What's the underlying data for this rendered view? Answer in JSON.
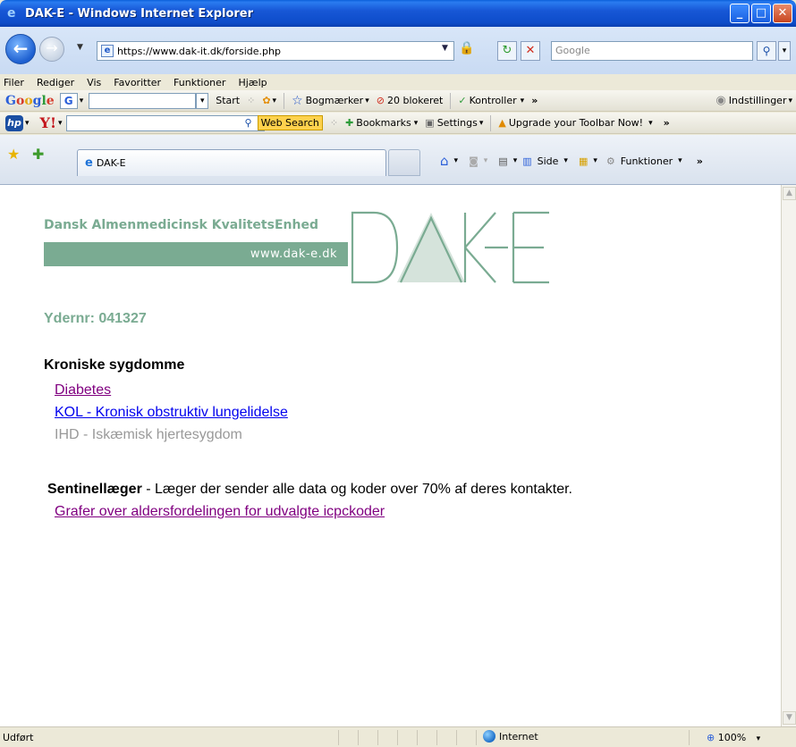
{
  "window": {
    "title": "DAK-E - Windows Internet Explorer"
  },
  "addressbar": {
    "url": "https://www.dak-it.dk/forside.php",
    "search_placeholder": "Google"
  },
  "menu": [
    "Filer",
    "Rediger",
    "Vis",
    "Favoritter",
    "Funktioner",
    "Hjælp"
  ],
  "google_toolbar": {
    "logo": [
      "G",
      "o",
      "o",
      "g",
      "l",
      "e"
    ],
    "g_button": "G",
    "start": "Start",
    "bookmarks": "Bogmærker",
    "blocked": "20 blokeret",
    "check": "Kontroller",
    "more": "»",
    "settings": "Indstillinger"
  },
  "yahoo_toolbar": {
    "hp": "hp",
    "yahoo": "Y!",
    "web_search": "Web Search",
    "bookmarks": "Bookmarks",
    "settings": "Settings",
    "upgrade": "Upgrade your Toolbar Now!",
    "more": "»"
  },
  "tabs": {
    "active_tab": "DAK-E",
    "commands": {
      "page": "Side",
      "tools": "Funktioner"
    }
  },
  "page": {
    "logo_title": "Dansk Almenmedicinsk KvalitetsEnhed",
    "logo_url": "www.dak-e.dk",
    "logo_mark": "DAK-E",
    "ydernr": "Ydernr: 041327",
    "chronic_heading": "Kroniske sygdomme",
    "links": [
      {
        "label": "Diabetes",
        "state": "visited"
      },
      {
        "label": "KOL - Kronisk obstruktiv lungelidelse",
        "state": "normal"
      }
    ],
    "disabled_item": "IHD - Iskæmisk hjertesygdom",
    "sentinel_bold": "Sentinellæger",
    "sentinel_text": " - Læger der sender alle data og koder over 70% af deres kontakter.",
    "graph_link": "Grafer over aldersfordelingen for udvalgte icpckoder"
  },
  "status": {
    "text": "Udført",
    "zone": "Internet",
    "zoom": "100%"
  },
  "colors": {
    "brand_green": "#7aab92",
    "visited": "#800080",
    "link": "#0000ee"
  }
}
